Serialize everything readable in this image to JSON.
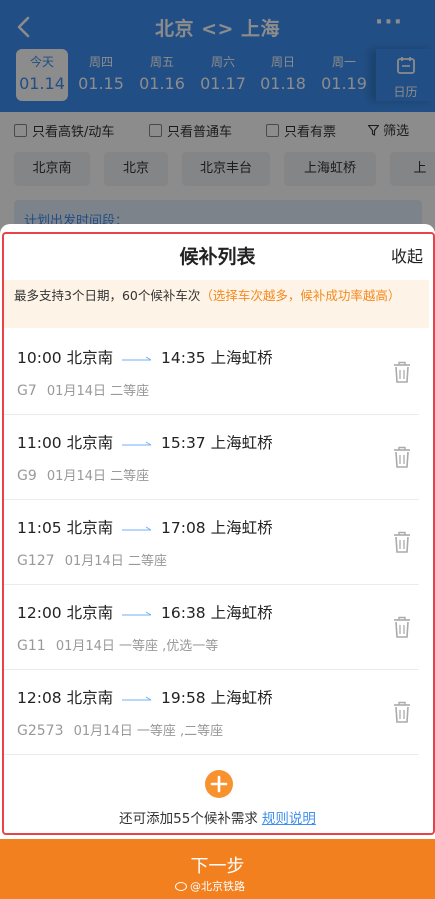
{
  "header": {
    "title": "北京 <> 上海",
    "more": "···",
    "dates": [
      {
        "weekday": "今天",
        "date": "01.14",
        "active": true
      },
      {
        "weekday": "周四",
        "date": "01.15",
        "active": false
      },
      {
        "weekday": "周五",
        "date": "01.16",
        "active": false
      },
      {
        "weekday": "周六",
        "date": "01.17",
        "active": false
      },
      {
        "weekday": "周日",
        "date": "01.18",
        "active": false
      },
      {
        "weekday": "周一",
        "date": "01.19",
        "active": false
      }
    ],
    "calendar_label": "日历"
  },
  "filters": {
    "checkboxes": [
      "只看高铁/动车",
      "只看普通车",
      "只看有票"
    ],
    "filter_label": "筛选",
    "stations": [
      "北京南",
      "北京",
      "北京丰台",
      "上海虹桥",
      "上"
    ],
    "plan_label": "计划出发时间段："
  },
  "sheet": {
    "title": "候补列表",
    "collapse": "收起",
    "notice_main": "最多支持3个日期，60个候补车次",
    "notice_highlight": "（选择车次越多，候补成功率越高）",
    "items": [
      {
        "dep_time": "10:00",
        "dep_station": "北京南",
        "arr_time": "14:35",
        "arr_station": "上海虹桥",
        "train": "G7",
        "date": "01月14日",
        "seat": "二等座"
      },
      {
        "dep_time": "11:00",
        "dep_station": "北京南",
        "arr_time": "15:37",
        "arr_station": "上海虹桥",
        "train": "G9",
        "date": "01月14日",
        "seat": "二等座"
      },
      {
        "dep_time": "11:05",
        "dep_station": "北京南",
        "arr_time": "17:08",
        "arr_station": "上海虹桥",
        "train": "G127",
        "date": "01月14日",
        "seat": "二等座"
      },
      {
        "dep_time": "12:00",
        "dep_station": "北京南",
        "arr_time": "16:38",
        "arr_station": "上海虹桥",
        "train": "G11",
        "date": "01月14日",
        "seat": "一等座 ,优选一等"
      },
      {
        "dep_time": "12:08",
        "dep_station": "北京南",
        "arr_time": "19:58",
        "arr_station": "上海虹桥",
        "train": "G2573",
        "date": "01月14日",
        "seat": "一等座 ,二等座"
      }
    ],
    "add_text": "还可添加55个候补需求",
    "rules_link": "规则说明"
  },
  "bottom": {
    "next_label": "下一步",
    "watermark": "@北京铁路"
  },
  "colors": {
    "primary": "#3d8ff0",
    "accent_orange": "#f2801f",
    "highlight_frame": "#e8434b"
  }
}
